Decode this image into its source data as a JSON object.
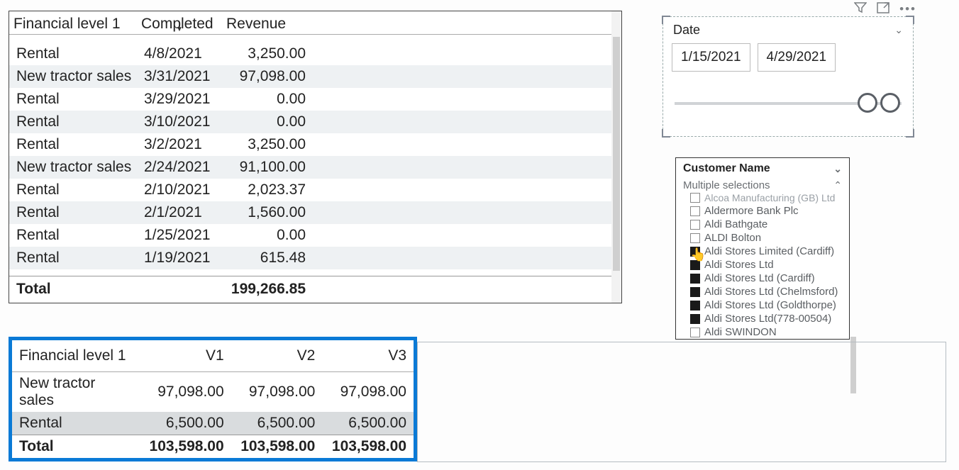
{
  "table1": {
    "headers": {
      "col1": "Financial level 1",
      "col2": "Completed",
      "col3": "Revenue"
    },
    "rows": [
      {
        "fin": "Rental",
        "date": "4/8/2021",
        "rev": "3,250.00"
      },
      {
        "fin": "New tractor sales",
        "date": "3/31/2021",
        "rev": "97,098.00"
      },
      {
        "fin": "Rental",
        "date": "3/29/2021",
        "rev": "0.00"
      },
      {
        "fin": "Rental",
        "date": "3/10/2021",
        "rev": "0.00"
      },
      {
        "fin": "Rental",
        "date": "3/2/2021",
        "rev": "3,250.00"
      },
      {
        "fin": "New tractor sales",
        "date": "2/24/2021",
        "rev": "91,100.00"
      },
      {
        "fin": "Rental",
        "date": "2/10/2021",
        "rev": "2,023.37"
      },
      {
        "fin": "Rental",
        "date": "2/1/2021",
        "rev": "1,560.00"
      },
      {
        "fin": "Rental",
        "date": "1/25/2021",
        "rev": "0.00"
      },
      {
        "fin": "Rental",
        "date": "1/19/2021",
        "rev": "615.48"
      }
    ],
    "total_label": "Total",
    "total_value": "199,266.85"
  },
  "table2": {
    "headers": {
      "col1": "Financial level 1",
      "col2": "V1",
      "col3": "V2",
      "col4": "V3"
    },
    "rows": [
      {
        "fin": "New tractor sales",
        "v1": "97,098.00",
        "v2": "97,098.00",
        "v3": "97,098.00"
      },
      {
        "fin": "Rental",
        "v1": "6,500.00",
        "v2": "6,500.00",
        "v3": "6,500.00"
      }
    ],
    "total_label": "Total",
    "totals": {
      "v1": "103,598.00",
      "v2": "103,598.00",
      "v3": "103,598.00"
    }
  },
  "date_slicer": {
    "title": "Date",
    "from": "1/15/2021",
    "to": "4/29/2021"
  },
  "customer_slicer": {
    "title": "Customer Name",
    "subtitle": "Multiple selections",
    "items": [
      {
        "label": "Alcoa Manufacturing (GB) Ltd",
        "checked": false,
        "cut": true
      },
      {
        "label": "Aldermore Bank Plc",
        "checked": false
      },
      {
        "label": "Aldi Bathgate",
        "checked": false
      },
      {
        "label": "ALDI Bolton",
        "checked": false
      },
      {
        "label": "Aldi Stores Limited (Cardiff)",
        "checked": true,
        "cursor": true
      },
      {
        "label": "Aldi Stores Ltd",
        "checked": true
      },
      {
        "label": "Aldi Stores Ltd (Cardiff)",
        "checked": true
      },
      {
        "label": "Aldi Stores Ltd (Chelmsford)",
        "checked": true
      },
      {
        "label": "Aldi Stores Ltd (Goldthorpe)",
        "checked": true
      },
      {
        "label": "Aldi Stores Ltd(778-00504)",
        "checked": true
      },
      {
        "label": "Aldi SWINDON",
        "checked": false
      }
    ]
  },
  "icons": {
    "filter": "filter-icon",
    "focus": "focus-mode-icon",
    "more": "more-options-icon"
  }
}
